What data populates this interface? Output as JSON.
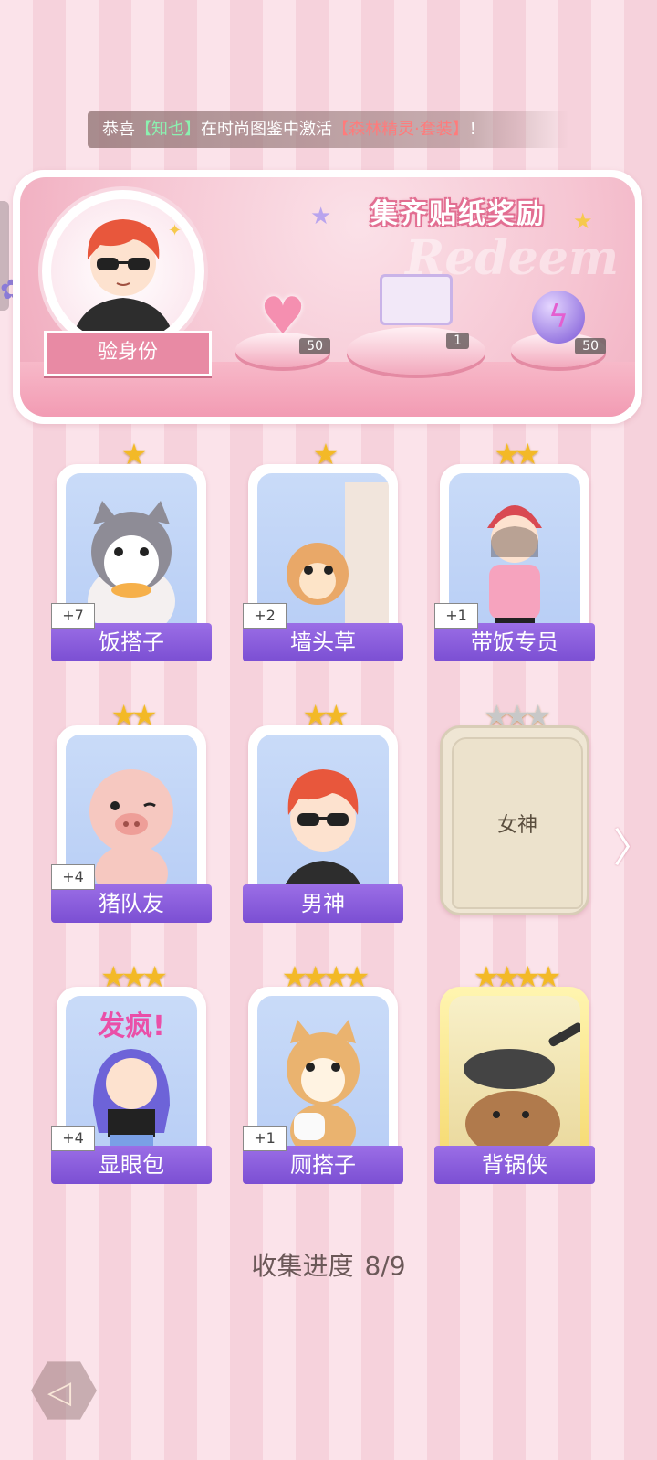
{
  "ticker": {
    "prefix": "恭喜",
    "user": "【知也】",
    "middle": "在时尚图鉴中激活",
    "item": "【森林精灵·套装】",
    "suffix": "！"
  },
  "reward": {
    "title": "集齐贴纸奖励",
    "deco_word": "Redeem",
    "verify_label": "验身份",
    "items": [
      {
        "name": "pink-heart-gem",
        "count": "50"
      },
      {
        "name": "gift-box",
        "count": "1"
      },
      {
        "name": "purple-energy-orb",
        "count": "50"
      }
    ]
  },
  "cards": [
    {
      "label": "饭搭子",
      "plus": "+7",
      "stars": "★",
      "icon": "cat-icon"
    },
    {
      "label": "墙头草",
      "plus": "+2",
      "stars": "★",
      "icon": "squirrel-icon"
    },
    {
      "label": "带饭专员",
      "plus": "+1",
      "stars": "★★",
      "icon": "girl-icon"
    },
    {
      "label": "猪队友",
      "plus": "+4",
      "stars": "★★",
      "icon": "pig-icon"
    },
    {
      "label": "男神",
      "plus": "",
      "stars": "★★",
      "icon": "boy-icon"
    },
    {
      "label": "女神",
      "plus": "",
      "stars": "★★★",
      "icon": "locked-card",
      "locked": true
    },
    {
      "label": "显眼包",
      "plus": "+4",
      "stars": "★★★",
      "icon": "crazy-girl-icon",
      "art_text": "发疯!"
    },
    {
      "label": "厕搭子",
      "plus": "+1",
      "stars": "★★★★",
      "icon": "shiba-icon"
    },
    {
      "label": "背锅侠",
      "plus": "",
      "stars": "★★★★",
      "icon": "capybara-pan-icon",
      "gold": true
    }
  ],
  "progress": {
    "label": "收集进度",
    "value": "8/9"
  },
  "colors": {
    "accent": "#8a5be0",
    "star": "#f3b927",
    "pink": "#e88aa4"
  }
}
